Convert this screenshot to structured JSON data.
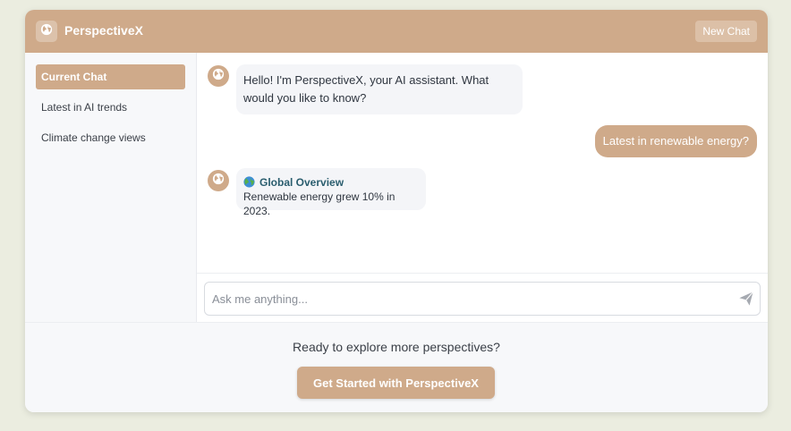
{
  "header": {
    "title": "PerspectiveX",
    "new_chat_label": "New Chat",
    "logo_icon": "globe-icon"
  },
  "sidebar": {
    "items": [
      {
        "label": "Current Chat",
        "active": true
      },
      {
        "label": "Latest in AI trends",
        "active": false
      },
      {
        "label": "Climate change views",
        "active": false
      }
    ]
  },
  "messages": [
    {
      "role": "assistant",
      "text": "Hello! I'm PerspectiveX, your AI assistant. What would you like to know?"
    },
    {
      "role": "user",
      "text": "Latest in renewable energy?"
    },
    {
      "role": "assistant",
      "heading": "Global Overview",
      "heading_icon": "earth-emoji-icon",
      "text": "Renewable energy grew 10% in 2023."
    }
  ],
  "composer": {
    "placeholder": "Ask me anything...",
    "value": "",
    "send_icon": "paper-plane-icon"
  },
  "footer": {
    "prompt": "Ready to explore more perspectives?",
    "cta_label": "Get Started with PerspectiveX"
  },
  "colors": {
    "accent": "#cfaa8a",
    "background": "#ebede0",
    "heading_text": "#2a5d6e"
  }
}
